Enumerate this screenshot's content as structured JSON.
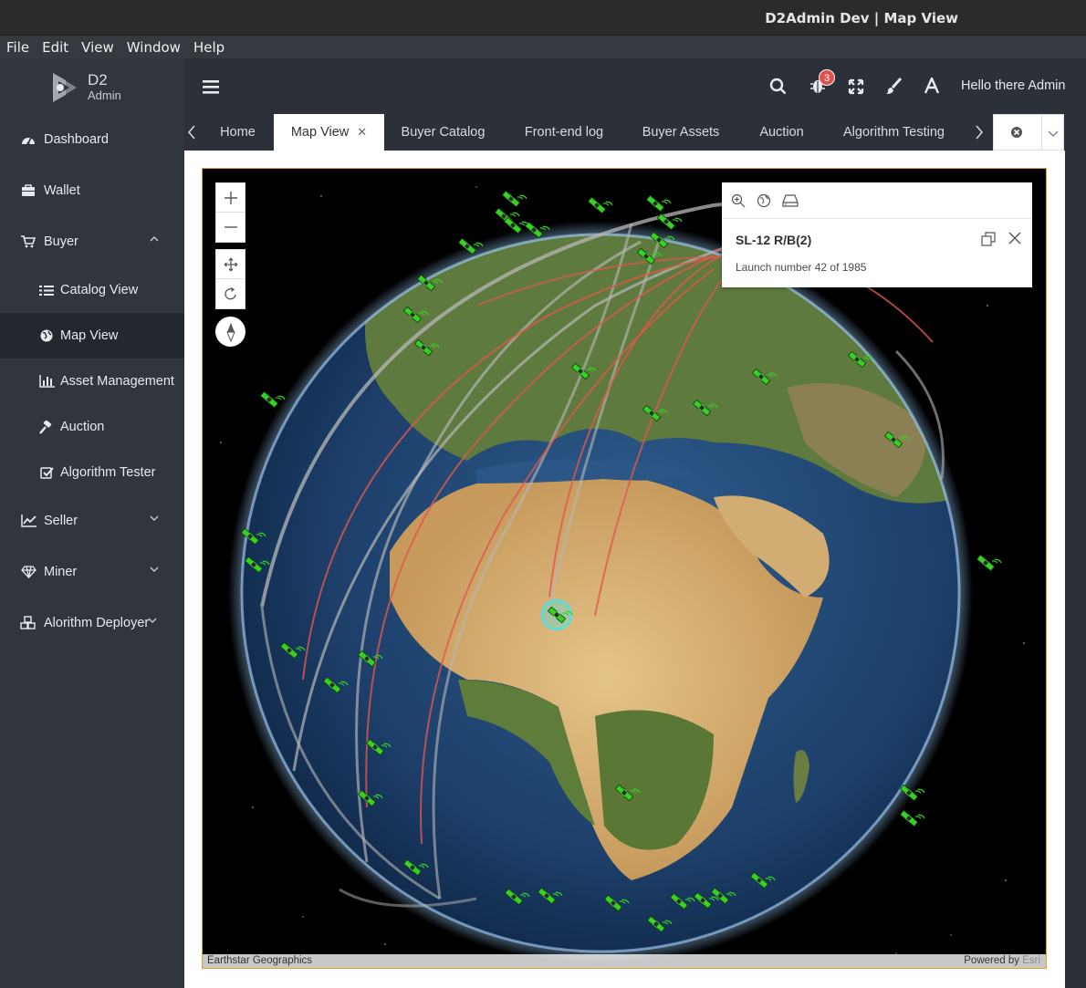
{
  "window": {
    "title": "D2Admin Dev | Map View"
  },
  "menubar": [
    "File",
    "Edit",
    "View",
    "Window",
    "Help"
  ],
  "logo": {
    "line1": "D2",
    "line2": "Admin"
  },
  "sidebar": {
    "items": [
      {
        "label": "Dashboard",
        "icon": "dashboard-icon"
      },
      {
        "label": "Wallet",
        "icon": "wallet-icon"
      },
      {
        "label": "Buyer",
        "icon": "cart-icon",
        "expanded": true
      },
      {
        "label": "Catalog View",
        "icon": "list-icon"
      },
      {
        "label": "Map View",
        "icon": "globe-icon",
        "active": true
      },
      {
        "label": "Asset Management",
        "icon": "bar-chart-icon"
      },
      {
        "label": "Auction",
        "icon": "gavel-icon"
      },
      {
        "label": "Algorithm Tester",
        "icon": "check-square-icon"
      },
      {
        "label": "Seller",
        "icon": "line-chart-icon"
      },
      {
        "label": "Miner",
        "icon": "diamond-icon"
      },
      {
        "label": "Alorithm Deployer",
        "icon": "cubes-icon"
      }
    ]
  },
  "header": {
    "greeting": "Hello there Admin",
    "notification_count": "3"
  },
  "tabs": [
    {
      "label": "Home"
    },
    {
      "label": "Map View",
      "active": true,
      "closable": true
    },
    {
      "label": "Buyer Catalog"
    },
    {
      "label": "Front-end log"
    },
    {
      "label": "Buyer Assets"
    },
    {
      "label": "Auction"
    },
    {
      "label": "Algorithm Testing"
    }
  ],
  "popup": {
    "title": "SL-12 R/B(2)",
    "description": "Launch number 42 of 1985"
  },
  "attribution": {
    "left": "Earthstar Geographics",
    "powered": "Powered by",
    "brand": "Esri"
  },
  "colors": {
    "sidebar": "#30353e",
    "active_item": "#232830",
    "satellite": "#3ddc2a",
    "orbit_red": "#e0584e",
    "orbit_gray": "#b8b8b8",
    "selected": "#3ee7f0"
  }
}
